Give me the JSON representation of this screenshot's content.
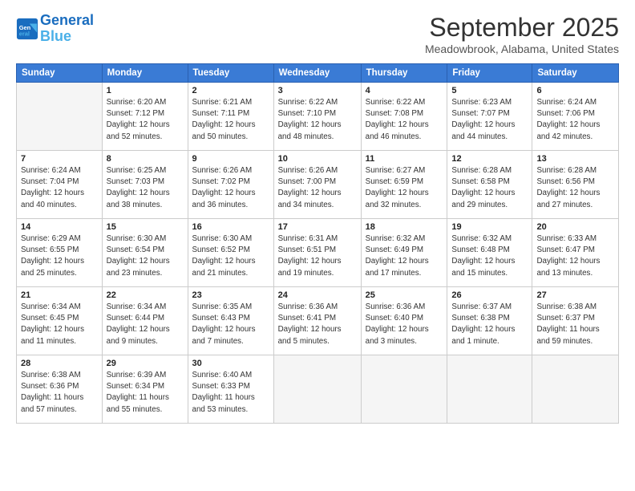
{
  "header": {
    "logo_line1": "General",
    "logo_line2": "Blue",
    "month": "September 2025",
    "location": "Meadowbrook, Alabama, United States"
  },
  "weekdays": [
    "Sunday",
    "Monday",
    "Tuesday",
    "Wednesday",
    "Thursday",
    "Friday",
    "Saturday"
  ],
  "weeks": [
    [
      {
        "day": "",
        "info": ""
      },
      {
        "day": "1",
        "info": "Sunrise: 6:20 AM\nSunset: 7:12 PM\nDaylight: 12 hours\nand 52 minutes."
      },
      {
        "day": "2",
        "info": "Sunrise: 6:21 AM\nSunset: 7:11 PM\nDaylight: 12 hours\nand 50 minutes."
      },
      {
        "day": "3",
        "info": "Sunrise: 6:22 AM\nSunset: 7:10 PM\nDaylight: 12 hours\nand 48 minutes."
      },
      {
        "day": "4",
        "info": "Sunrise: 6:22 AM\nSunset: 7:08 PM\nDaylight: 12 hours\nand 46 minutes."
      },
      {
        "day": "5",
        "info": "Sunrise: 6:23 AM\nSunset: 7:07 PM\nDaylight: 12 hours\nand 44 minutes."
      },
      {
        "day": "6",
        "info": "Sunrise: 6:24 AM\nSunset: 7:06 PM\nDaylight: 12 hours\nand 42 minutes."
      }
    ],
    [
      {
        "day": "7",
        "info": "Sunrise: 6:24 AM\nSunset: 7:04 PM\nDaylight: 12 hours\nand 40 minutes."
      },
      {
        "day": "8",
        "info": "Sunrise: 6:25 AM\nSunset: 7:03 PM\nDaylight: 12 hours\nand 38 minutes."
      },
      {
        "day": "9",
        "info": "Sunrise: 6:26 AM\nSunset: 7:02 PM\nDaylight: 12 hours\nand 36 minutes."
      },
      {
        "day": "10",
        "info": "Sunrise: 6:26 AM\nSunset: 7:00 PM\nDaylight: 12 hours\nand 34 minutes."
      },
      {
        "day": "11",
        "info": "Sunrise: 6:27 AM\nSunset: 6:59 PM\nDaylight: 12 hours\nand 32 minutes."
      },
      {
        "day": "12",
        "info": "Sunrise: 6:28 AM\nSunset: 6:58 PM\nDaylight: 12 hours\nand 29 minutes."
      },
      {
        "day": "13",
        "info": "Sunrise: 6:28 AM\nSunset: 6:56 PM\nDaylight: 12 hours\nand 27 minutes."
      }
    ],
    [
      {
        "day": "14",
        "info": "Sunrise: 6:29 AM\nSunset: 6:55 PM\nDaylight: 12 hours\nand 25 minutes."
      },
      {
        "day": "15",
        "info": "Sunrise: 6:30 AM\nSunset: 6:54 PM\nDaylight: 12 hours\nand 23 minutes."
      },
      {
        "day": "16",
        "info": "Sunrise: 6:30 AM\nSunset: 6:52 PM\nDaylight: 12 hours\nand 21 minutes."
      },
      {
        "day": "17",
        "info": "Sunrise: 6:31 AM\nSunset: 6:51 PM\nDaylight: 12 hours\nand 19 minutes."
      },
      {
        "day": "18",
        "info": "Sunrise: 6:32 AM\nSunset: 6:49 PM\nDaylight: 12 hours\nand 17 minutes."
      },
      {
        "day": "19",
        "info": "Sunrise: 6:32 AM\nSunset: 6:48 PM\nDaylight: 12 hours\nand 15 minutes."
      },
      {
        "day": "20",
        "info": "Sunrise: 6:33 AM\nSunset: 6:47 PM\nDaylight: 12 hours\nand 13 minutes."
      }
    ],
    [
      {
        "day": "21",
        "info": "Sunrise: 6:34 AM\nSunset: 6:45 PM\nDaylight: 12 hours\nand 11 minutes."
      },
      {
        "day": "22",
        "info": "Sunrise: 6:34 AM\nSunset: 6:44 PM\nDaylight: 12 hours\nand 9 minutes."
      },
      {
        "day": "23",
        "info": "Sunrise: 6:35 AM\nSunset: 6:43 PM\nDaylight: 12 hours\nand 7 minutes."
      },
      {
        "day": "24",
        "info": "Sunrise: 6:36 AM\nSunset: 6:41 PM\nDaylight: 12 hours\nand 5 minutes."
      },
      {
        "day": "25",
        "info": "Sunrise: 6:36 AM\nSunset: 6:40 PM\nDaylight: 12 hours\nand 3 minutes."
      },
      {
        "day": "26",
        "info": "Sunrise: 6:37 AM\nSunset: 6:38 PM\nDaylight: 12 hours\nand 1 minute."
      },
      {
        "day": "27",
        "info": "Sunrise: 6:38 AM\nSunset: 6:37 PM\nDaylight: 11 hours\nand 59 minutes."
      }
    ],
    [
      {
        "day": "28",
        "info": "Sunrise: 6:38 AM\nSunset: 6:36 PM\nDaylight: 11 hours\nand 57 minutes."
      },
      {
        "day": "29",
        "info": "Sunrise: 6:39 AM\nSunset: 6:34 PM\nDaylight: 11 hours\nand 55 minutes."
      },
      {
        "day": "30",
        "info": "Sunrise: 6:40 AM\nSunset: 6:33 PM\nDaylight: 11 hours\nand 53 minutes."
      },
      {
        "day": "",
        "info": ""
      },
      {
        "day": "",
        "info": ""
      },
      {
        "day": "",
        "info": ""
      },
      {
        "day": "",
        "info": ""
      }
    ]
  ]
}
